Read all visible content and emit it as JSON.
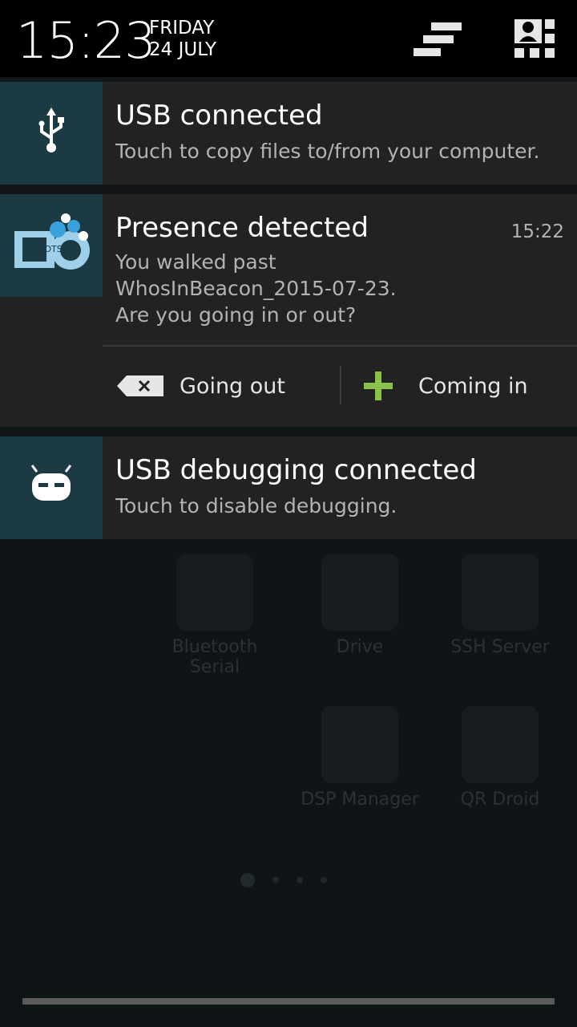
{
  "status_header": {
    "time": "15:23",
    "day": "FRIDAY",
    "date": "24 JULY"
  },
  "notifications": {
    "usb": {
      "title": "USB connected",
      "text": "Touch to copy files to/from your computer.",
      "icon": "usb-icon"
    },
    "presence": {
      "title": "Presence detected",
      "time": "15:22",
      "line1": "You walked past",
      "line2": "WhosInBeacon_2015-07-23.",
      "line3": "Are you going in or out?",
      "icon": "app-logo-icon",
      "logo_text": "BOTS",
      "actions": {
        "out": "Going out",
        "in": "Coming in"
      }
    },
    "debug": {
      "title": "USB debugging connected",
      "text": "Touch to disable debugging.",
      "icon": "cyanogen-bot-icon"
    }
  },
  "homescreen": {
    "apps": [
      "Bluetooth Serial",
      "Drive",
      "SSH Server",
      "DSP Manager",
      "QR Droid"
    ]
  },
  "colors": {
    "header_bg": "#000000",
    "notif_bg": "#222222",
    "icon_bg": "#1c3a44",
    "accent_green": "#8bc34a"
  }
}
